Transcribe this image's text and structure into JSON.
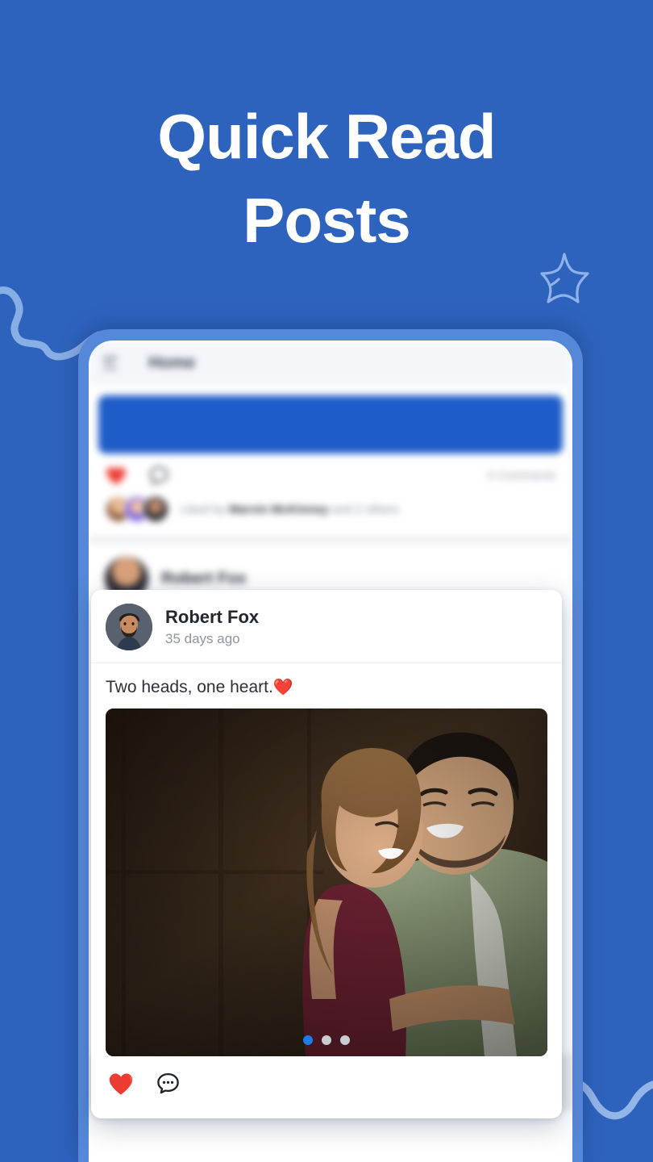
{
  "theme": {
    "background_blue": "#2E63BD",
    "phone_bezel_blue": "#5588D8",
    "banner_blue": "#1E5CC8",
    "accent_dot_blue": "#1E7CE8",
    "heart_red": "#ED3B32"
  },
  "headline": {
    "line1": "Quick Read",
    "line2": "Posts"
  },
  "decorations": {
    "star": "star-doodle",
    "wave_left": "wave-doodle",
    "wave_right": "wave-doodle"
  },
  "phone": {
    "app_bar": {
      "menu_icon": "hamburger-menu-icon",
      "title": "Home"
    },
    "background_post": {
      "like_icon": "heart-icon",
      "comment_icon": "comment-bubble-icon",
      "comment_count": "0 Comments",
      "liked_by_prefix": "Liked by ",
      "liked_by_name": "Marvin McKinney",
      "liked_by_suffix": " and 2 others"
    },
    "ghost_post": {
      "author": "Robert Fox"
    }
  },
  "post_card": {
    "avatar": "user-avatar",
    "author": "Robert Fox",
    "timestamp": "35 days ago",
    "text": "Two heads, one heart.",
    "text_emoji": "❤️",
    "media": {
      "alt": "couple-embracing-photo",
      "carousel_dots": 3,
      "active_dot": 1
    },
    "actions": {
      "like_icon": "heart-icon",
      "comment_icon": "comment-bubble-icon"
    }
  }
}
